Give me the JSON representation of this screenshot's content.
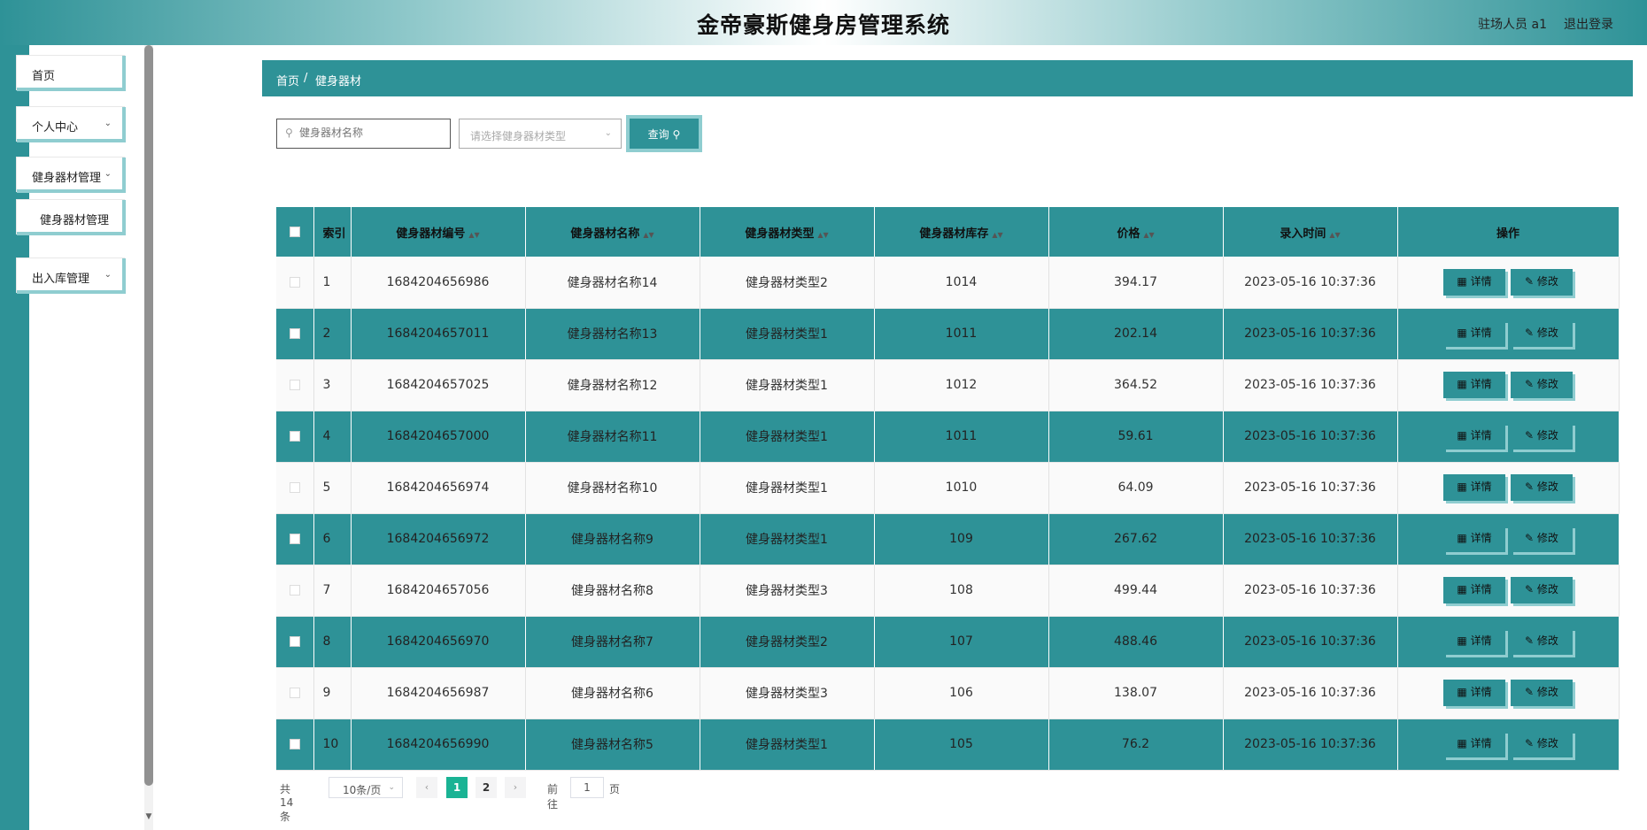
{
  "header": {
    "title": "金帝豪斯健身房管理系统",
    "user": "驻场人员 a1",
    "logout": "退出登录"
  },
  "sidebar": {
    "items": [
      {
        "label": "首页",
        "has_arrow": false
      },
      {
        "label": "个人中心",
        "has_arrow": true
      },
      {
        "label": "健身器材管理",
        "has_arrow": true
      },
      {
        "label": "健身器材管理",
        "has_arrow": false
      },
      {
        "label": "出入库管理",
        "has_arrow": true
      }
    ]
  },
  "breadcrumb": {
    "home": "首页",
    "sep": "/",
    "current": "健身器材"
  },
  "search": {
    "name_placeholder": "健身器材名称",
    "type_placeholder": "请选择健身器材类型",
    "query_label": "查询"
  },
  "table": {
    "headers": {
      "index": "索引",
      "code": "健身器材编号",
      "name": "健身器材名称",
      "type": "健身器材类型",
      "stock": "健身器材库存",
      "price": "价格",
      "time": "录入时间",
      "ops": "操作"
    },
    "detail_label": "详情",
    "edit_label": "修改",
    "rows": [
      {
        "index": "1",
        "code": "1684204656986",
        "name": "健身器材名称14",
        "type": "健身器材类型2",
        "stock": "1014",
        "price": "394.17",
        "time": "2023-05-16 10:37:36"
      },
      {
        "index": "2",
        "code": "1684204657011",
        "name": "健身器材名称13",
        "type": "健身器材类型1",
        "stock": "1011",
        "price": "202.14",
        "time": "2023-05-16 10:37:36"
      },
      {
        "index": "3",
        "code": "1684204657025",
        "name": "健身器材名称12",
        "type": "健身器材类型1",
        "stock": "1012",
        "price": "364.52",
        "time": "2023-05-16 10:37:36"
      },
      {
        "index": "4",
        "code": "1684204657000",
        "name": "健身器材名称11",
        "type": "健身器材类型1",
        "stock": "1011",
        "price": "59.61",
        "time": "2023-05-16 10:37:36"
      },
      {
        "index": "5",
        "code": "1684204656974",
        "name": "健身器材名称10",
        "type": "健身器材类型1",
        "stock": "1010",
        "price": "64.09",
        "time": "2023-05-16 10:37:36"
      },
      {
        "index": "6",
        "code": "1684204656972",
        "name": "健身器材名称9",
        "type": "健身器材类型1",
        "stock": "109",
        "price": "267.62",
        "time": "2023-05-16 10:37:36"
      },
      {
        "index": "7",
        "code": "1684204657056",
        "name": "健身器材名称8",
        "type": "健身器材类型3",
        "stock": "108",
        "price": "499.44",
        "time": "2023-05-16 10:37:36"
      },
      {
        "index": "8",
        "code": "1684204656970",
        "name": "健身器材名称7",
        "type": "健身器材类型2",
        "stock": "107",
        "price": "488.46",
        "time": "2023-05-16 10:37:36"
      },
      {
        "index": "9",
        "code": "1684204656987",
        "name": "健身器材名称6",
        "type": "健身器材类型3",
        "stock": "106",
        "price": "138.07",
        "time": "2023-05-16 10:37:36"
      },
      {
        "index": "10",
        "code": "1684204656990",
        "name": "健身器材名称5",
        "type": "健身器材类型1",
        "stock": "105",
        "price": "76.2",
        "time": "2023-05-16 10:37:36"
      }
    ]
  },
  "pagination": {
    "total": "共 14 条",
    "page_size": "10条/页",
    "pages": [
      "1",
      "2"
    ],
    "current_page": "1",
    "goto_label": "前往",
    "goto_value": "1",
    "page_suffix": "页"
  },
  "colors": {
    "primary": "#2e9297",
    "accent_light": "#8fcdd0",
    "pager_active": "#1ab394"
  }
}
